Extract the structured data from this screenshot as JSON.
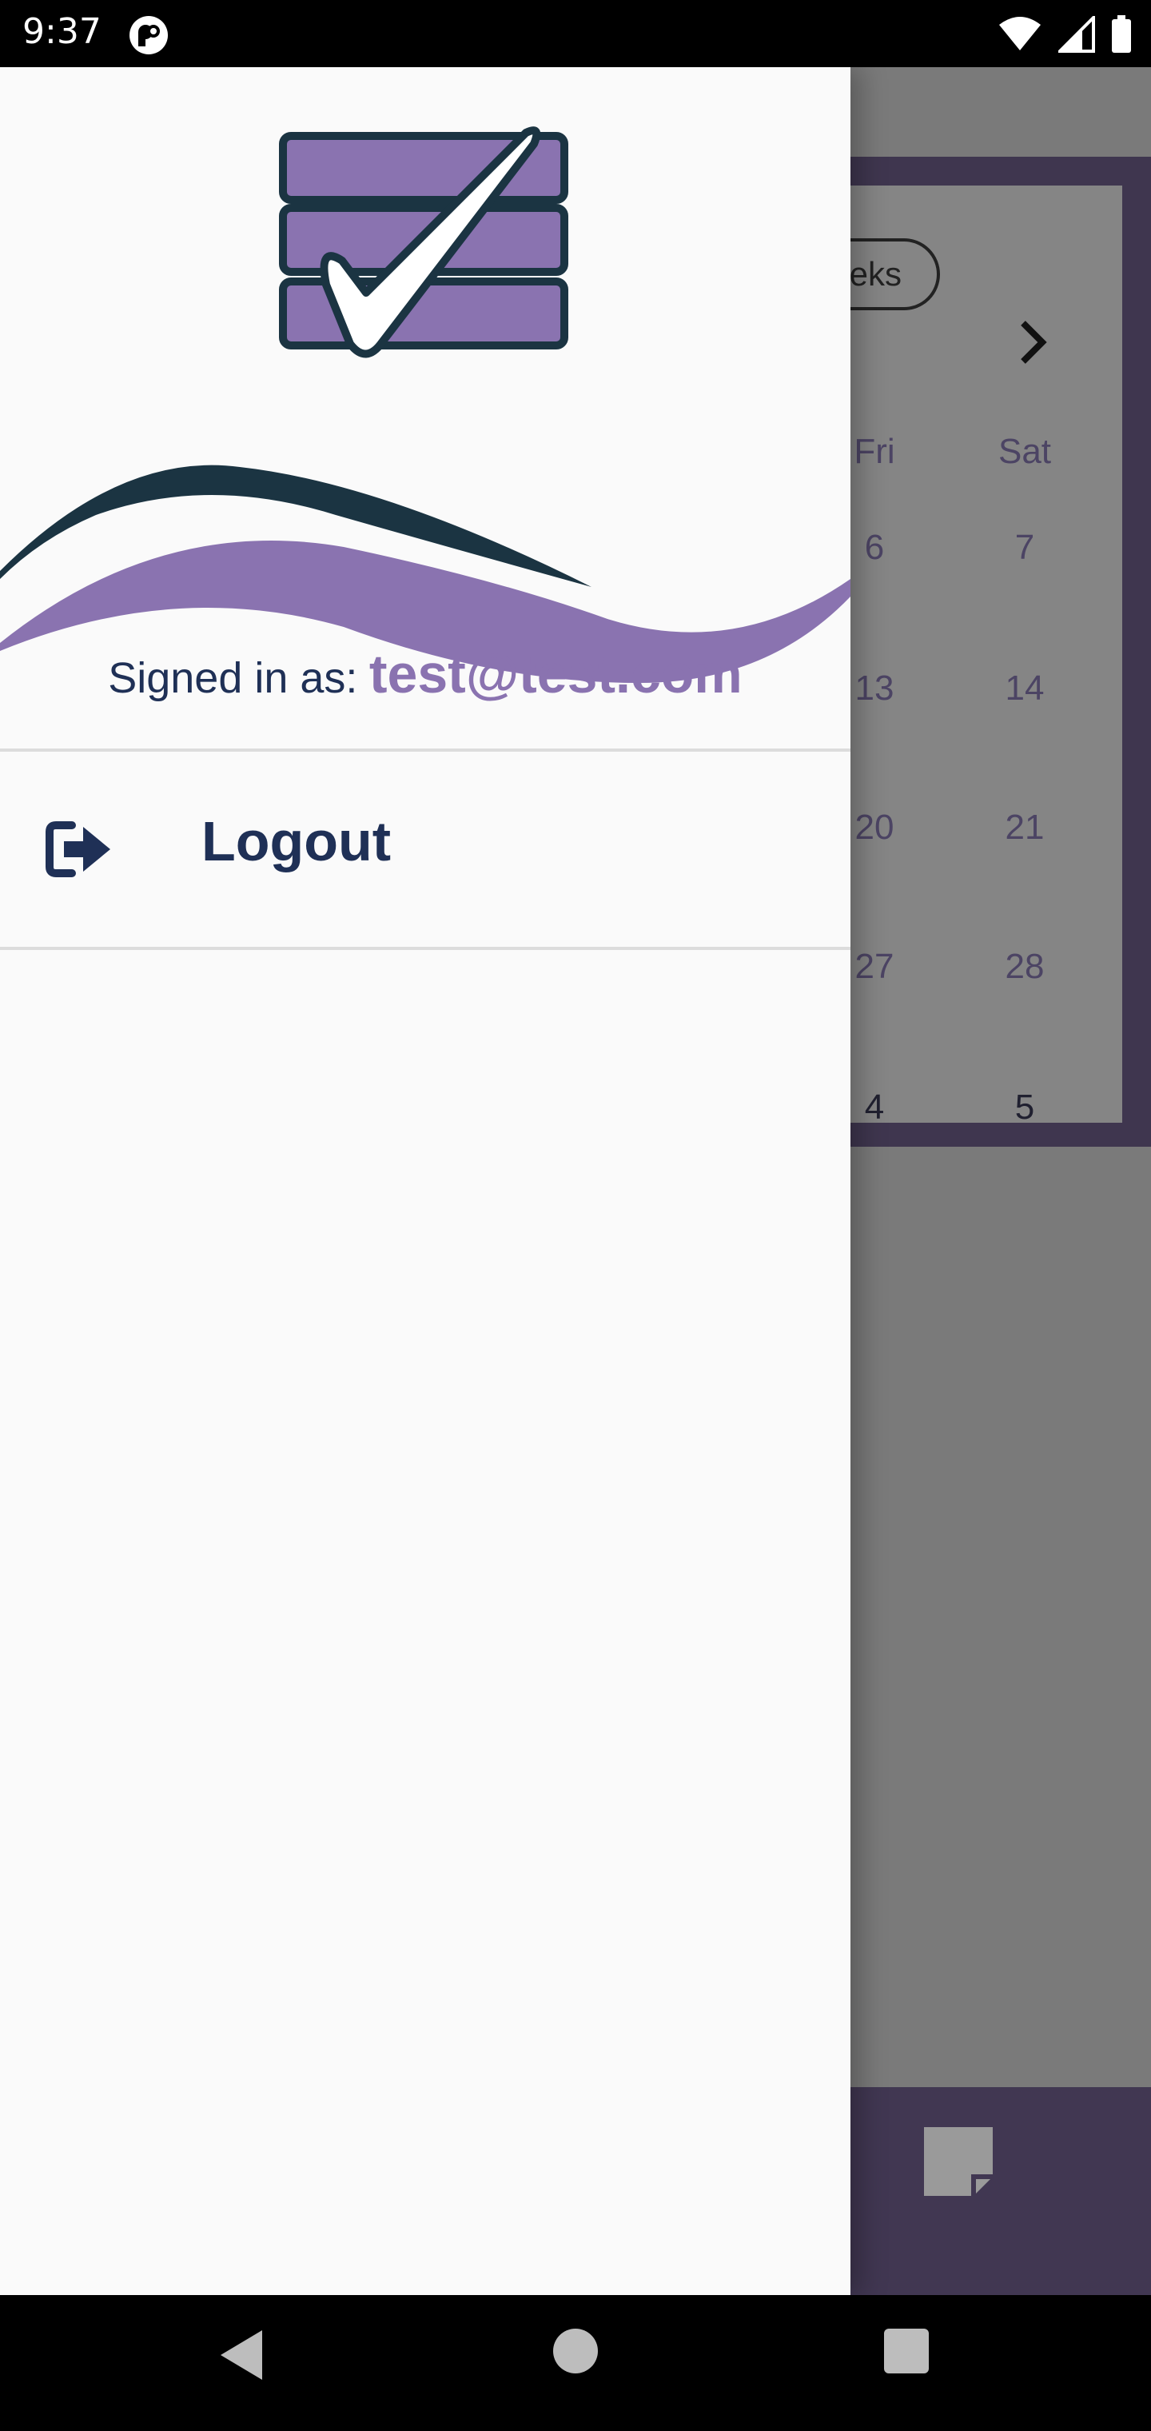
{
  "status_bar": {
    "time": "9:37",
    "app_icon": "p-badge-icon",
    "icons": [
      "wifi-icon",
      "signal-icon",
      "battery-icon"
    ]
  },
  "background_app": {
    "view_toggle_partial": "eeks",
    "day_headers": [
      "Fri",
      "Sat"
    ],
    "dates": [
      [
        "6",
        "7"
      ],
      [
        "13",
        "14"
      ],
      [
        "20",
        "21"
      ],
      [
        "27",
        "28"
      ],
      [
        "4",
        "5"
      ]
    ],
    "next_month_icon": "chevron-right-icon",
    "bottom_icon": "note-icon"
  },
  "drawer": {
    "signed_in_label": "Signed in as:",
    "signed_in_email": "test@test.com",
    "menu": {
      "logout_label": "Logout",
      "logout_icon": "logout-icon"
    }
  },
  "colors": {
    "accent": "#8a73b0",
    "navy": "#1f3056",
    "frame": "#3f364f"
  },
  "nav_bar": {
    "icons": [
      "back-icon",
      "home-icon",
      "recents-icon"
    ]
  }
}
